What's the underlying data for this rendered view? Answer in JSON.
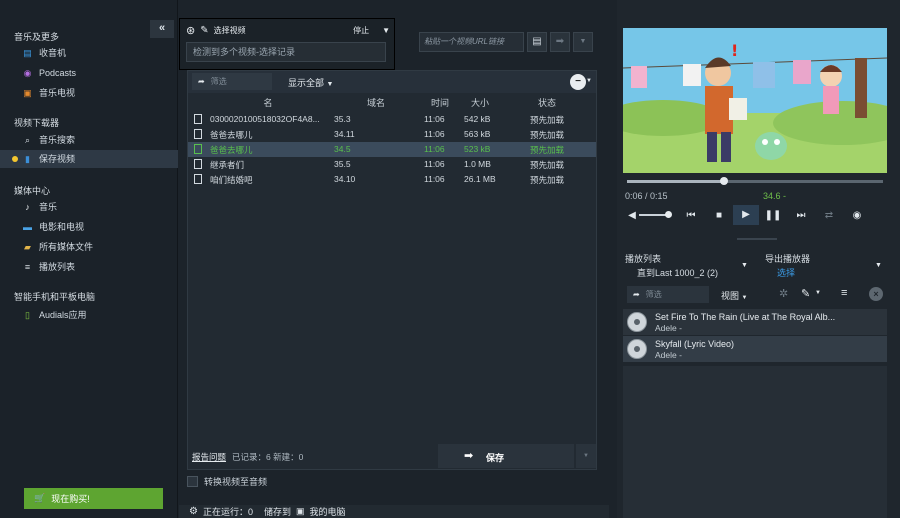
{
  "sidebar": {
    "section_music": "音乐及更多",
    "music_items": [
      {
        "label": "收音机",
        "icon": "radio-icon"
      },
      {
        "label": "Podcasts",
        "icon": "podcast-icon"
      },
      {
        "label": "音乐电视",
        "icon": "music-tv-icon"
      }
    ],
    "section_video": "视频下载器",
    "video_items": [
      {
        "label": "音乐搜索",
        "icon": "search-icon"
      },
      {
        "label": "保存视频",
        "icon": "video-file-icon"
      }
    ],
    "section_media": "媒体中心",
    "media_items": [
      {
        "label": "音乐",
        "icon": "music-note-icon"
      },
      {
        "label": "电影和电视",
        "icon": "tv-icon"
      },
      {
        "label": "所有媒体文件",
        "icon": "folder-icon"
      },
      {
        "label": "播放列表",
        "icon": "playlist-icon"
      }
    ],
    "section_devices": "智能手机和平板电脑",
    "device_items": [
      {
        "label": "Audials应用",
        "icon": "phone-icon"
      }
    ],
    "buy_label": "现在购买!",
    "collapse_label": "«"
  },
  "url_panel": {
    "select_video_label": "选择视频",
    "stop_label": "停止",
    "detected_text": "检测到多个视频-选择记录"
  },
  "link_bar": {
    "placeholder": "粘贴一个视频URL链接"
  },
  "list": {
    "filter_placeholder": "筛选",
    "show_all": "显示全部",
    "columns": [
      "名",
      "域名",
      "时间",
      "大小",
      "状态"
    ],
    "rows": [
      {
        "name": "0300020100518032OF4A8...",
        "domain": "35.3",
        "time": "11:06",
        "size": "542 kB",
        "status": "预先加载"
      },
      {
        "name": "爸爸去哪儿",
        "domain": "34.11",
        "time": "11:06",
        "size": "563 kB",
        "status": "预先加载"
      },
      {
        "name": "爸爸去哪儿",
        "domain": "34.5",
        "time": "11:06",
        "size": "523 kB",
        "status": "预先加载"
      },
      {
        "name": "继承者们",
        "domain": "35.5",
        "time": "11:06",
        "size": "1.0 MB",
        "status": "预先加载"
      },
      {
        "name": "咱们结婚吧",
        "domain": "34.10",
        "time": "11:06",
        "size": "26.1 MB",
        "status": "预先加载"
      }
    ],
    "selected_index": 2,
    "footer_report": "报告问题",
    "footer_stats": "已记录：6  新建：0",
    "save_label": "保存",
    "convert_label": "转换视频至音频"
  },
  "status": {
    "running": "正在运行：0",
    "storage": "储存到",
    "pc": "我的电脑"
  },
  "player": {
    "time_elapsed": "0:06 / 0:15",
    "time_label": "34.6 -",
    "seek_fraction": 0.38
  },
  "playlist": {
    "header_label": "播放列表",
    "playlist_name": "直到Last 1000_2 (2)",
    "export_label": "导出播放器",
    "export_value": "选择",
    "filter_placeholder": "筛选",
    "tools_label": "视图",
    "items": [
      {
        "title": "Set Fire To The Rain (Live at The Royal Alb...",
        "artist": "Adele -"
      },
      {
        "title": "Skyfall (Lyric Video)",
        "artist": "Adele -"
      }
    ]
  },
  "colors": {
    "accent_green": "#5ea531",
    "selected_text": "#59c04d",
    "active_dot": "#f3c62f"
  }
}
